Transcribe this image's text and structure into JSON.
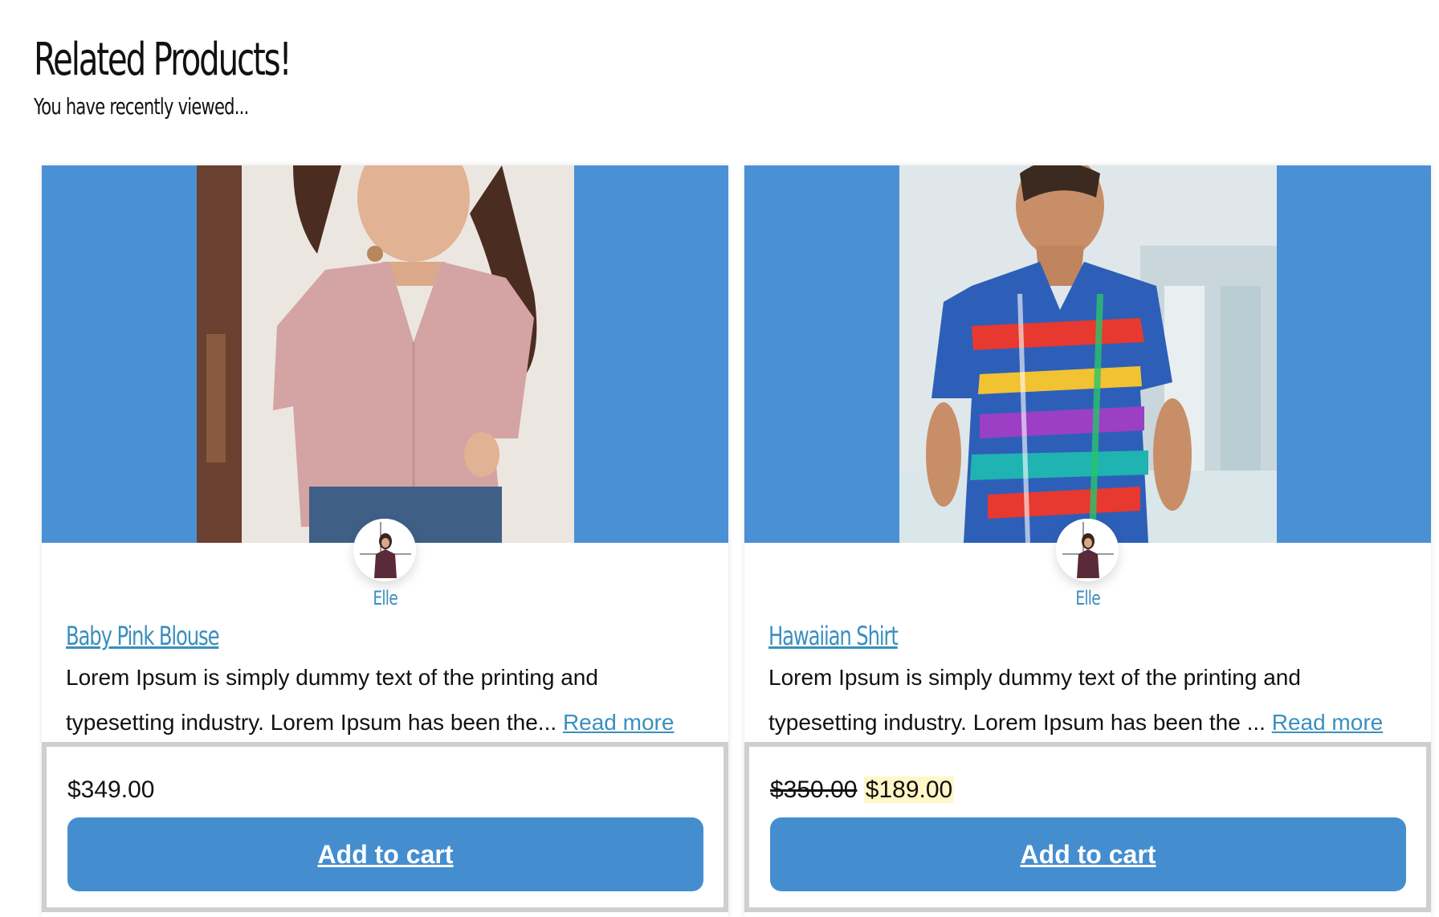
{
  "header": {
    "title": "Related Products!",
    "subtitle": "You have recently viewed..."
  },
  "colors": {
    "card_banner": "#4a90d4",
    "link": "#3a8fbf",
    "button": "#448ed0",
    "sale_highlight": "#fff7c8"
  },
  "products": [
    {
      "image_icon": "pink-blouse-photo",
      "vendor": "Elle",
      "title": "Baby Pink Blouse",
      "description_line1": "Lorem Ipsum is simply dummy text of the printing and",
      "description_line2": "typesetting industry. Lorem Ipsum has been the...",
      "read_more": "Read more",
      "price": "$349.00",
      "old_price": "",
      "add_to_cart": "Add to cart"
    },
    {
      "image_icon": "hawaiian-shirt-photo",
      "vendor": "Elle",
      "title": "Hawaiian Shirt",
      "description_line1": "Lorem Ipsum is simply dummy text of the printing and",
      "description_line2": "typesetting industry. Lorem Ipsum has been the ...",
      "read_more": "Read more",
      "old_price": "$350.00",
      "price": "$189.00",
      "add_to_cart": "Add to cart"
    }
  ]
}
